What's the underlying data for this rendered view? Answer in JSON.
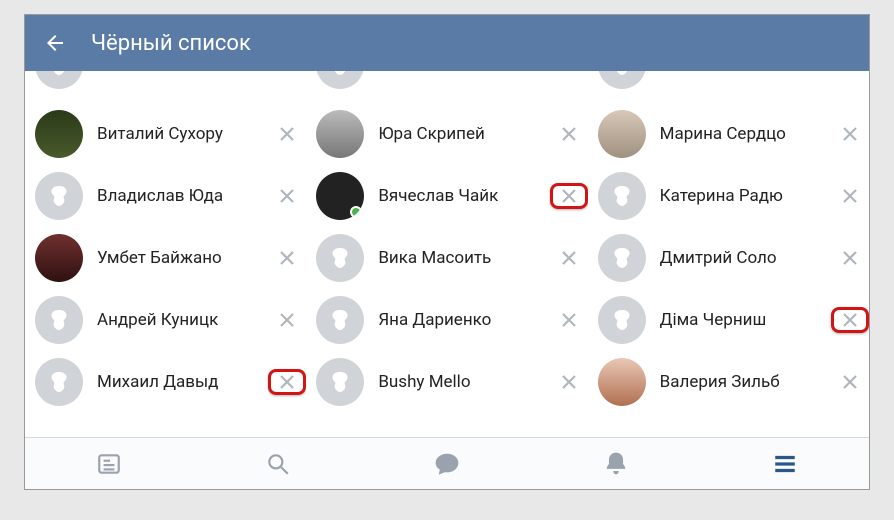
{
  "header": {
    "title": "Чёрный список"
  },
  "users": {
    "r1c1": {
      "name": "Виталий Сухору",
      "avatar": "photo1"
    },
    "r1c2": {
      "name": "Юра Скрипей",
      "avatar": "photo2"
    },
    "r1c3": {
      "name": "Марина Сердцо",
      "avatar": "photo5"
    },
    "r2c1": {
      "name": "Владислав Юда",
      "avatar": "placeholder"
    },
    "r2c2": {
      "name": "Вячеслав Чайк",
      "avatar": "photo6",
      "online": true
    },
    "r2c3": {
      "name": "Катерина Радю",
      "avatar": "placeholder"
    },
    "r3c1": {
      "name": "Умбет Байжано",
      "avatar": "photo3"
    },
    "r3c2": {
      "name": "Вика Масоить",
      "avatar": "placeholder"
    },
    "r3c3": {
      "name": "Дмитрий Соло",
      "avatar": "placeholder"
    },
    "r4c1": {
      "name": "Андрей Куницк",
      "avatar": "placeholder"
    },
    "r4c2": {
      "name": "Яна Дариенко",
      "avatar": "placeholder"
    },
    "r4c3": {
      "name": "Діма Черниш",
      "avatar": "placeholder"
    },
    "r5c1": {
      "name": "Михаил Давыд",
      "avatar": "placeholder"
    },
    "r5c2": {
      "name": "Bushy Mello",
      "avatar": "placeholder"
    },
    "r5c3": {
      "name": "Валерия Зильб",
      "avatar": "photo4"
    }
  },
  "highlights": [
    "r2c2",
    "r4c3",
    "r5c1"
  ],
  "nav": {
    "active": "menu"
  }
}
